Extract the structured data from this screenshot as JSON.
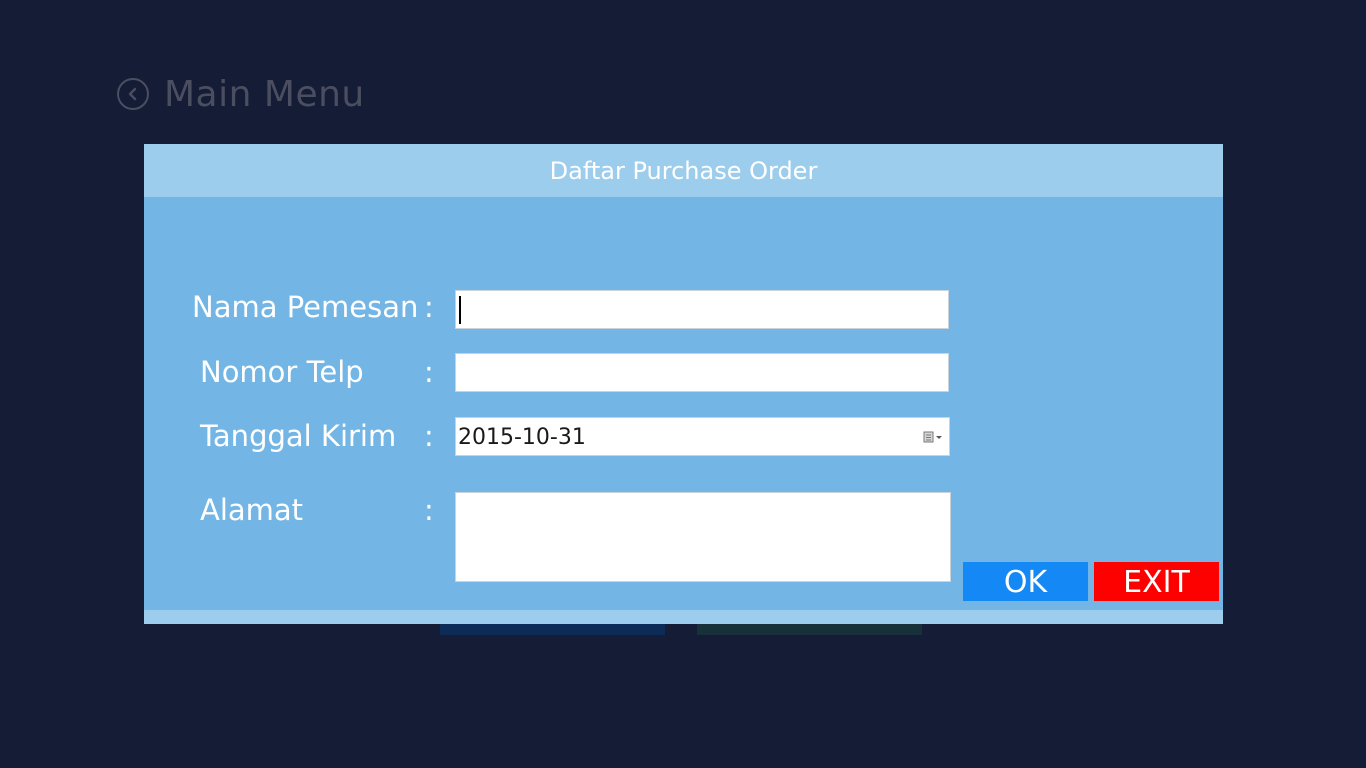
{
  "header": {
    "title": "Main Menu",
    "back_icon": "chevron-left-circle-icon"
  },
  "dialog": {
    "title": "Daftar Purchase Order",
    "fields": {
      "nama_pemesan": {
        "label": "Nama Pemesan",
        "colon": ":",
        "value": ""
      },
      "nomor_telp": {
        "label": "Nomor Telp",
        "colon": ":",
        "value": ""
      },
      "tanggal_kirim": {
        "label": "Tanggal Kirim",
        "colon": ":",
        "value": "2015-10-31",
        "icon": "calendar-dropdown-icon"
      },
      "alamat": {
        "label": "Alamat",
        "colon": ":",
        "value": ""
      }
    },
    "buttons": {
      "ok": "OK",
      "exit": "EXIT"
    }
  },
  "colors": {
    "background": "#151c36",
    "dialog_body": "#73b6e5",
    "dialog_bar": "#9dcdec",
    "ok_button": "#1488f5",
    "exit_button": "#fd0000",
    "tile_left": "#0d2b57",
    "tile_right": "#17303a"
  }
}
